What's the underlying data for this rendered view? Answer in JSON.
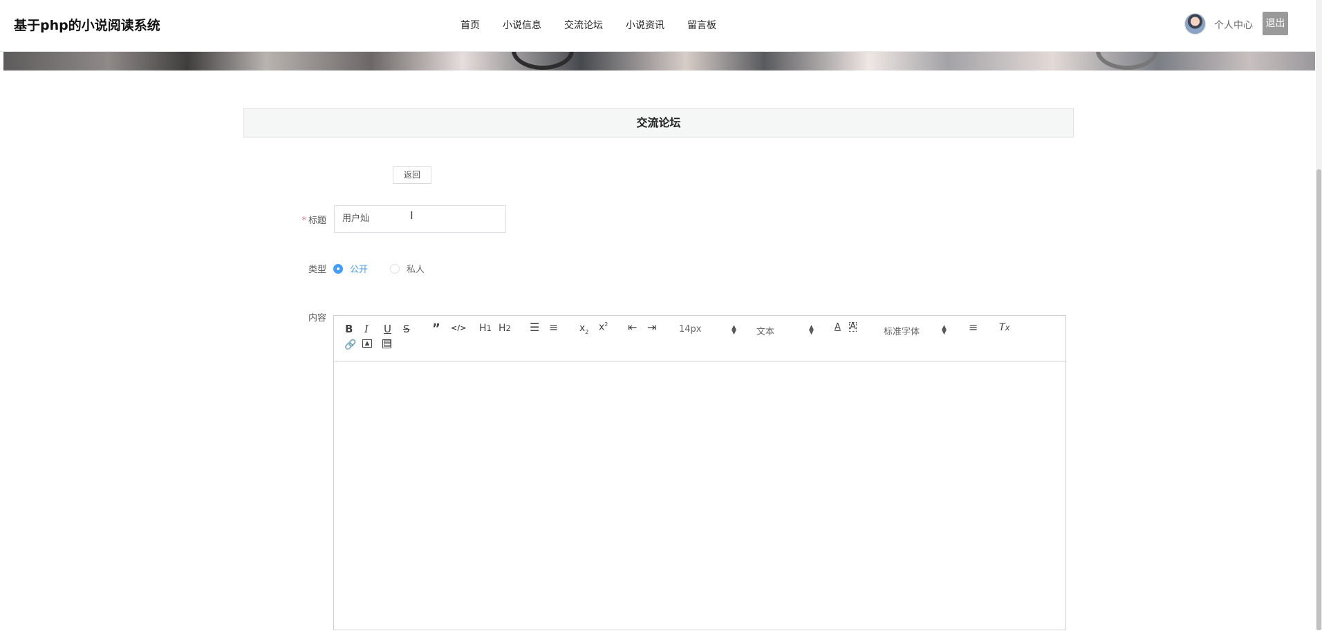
{
  "header": {
    "brand": "基于php的小说阅读系统",
    "nav": [
      "首页",
      "小说信息",
      "交流论坛",
      "小说资讯",
      "留言板"
    ],
    "user_center": "个人中心",
    "logout": "退出"
  },
  "section": {
    "title": "交流论坛"
  },
  "form": {
    "back_label": "返回",
    "title_label": "标题",
    "title_value": "用户灿",
    "type_label": "类型",
    "type_options": [
      "公开",
      "私人"
    ],
    "type_selected": "公开",
    "content_label": "内容"
  },
  "editor": {
    "font_size": "14px",
    "text_style": "文本",
    "font_family": "标准字体",
    "tools_icons": [
      "bold-icon",
      "italic-icon",
      "underline-icon",
      "strike-icon",
      "quote-icon",
      "code-icon",
      "h1-icon",
      "h2-icon",
      "ordered-list-icon",
      "bullet-list-icon",
      "subscript-icon",
      "superscript-icon",
      "outdent-icon",
      "indent-icon",
      "color-icon",
      "background-icon",
      "align-icon",
      "clear-format-icon",
      "link-icon",
      "image-icon",
      "video-icon"
    ]
  },
  "colors": {
    "accent": "#409eff",
    "required": "#f56c6c",
    "logout_bg": "#9a9a9a"
  }
}
